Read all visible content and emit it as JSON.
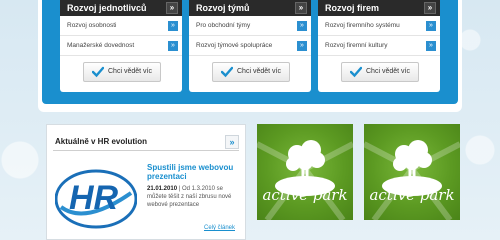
{
  "cards": [
    {
      "title": "Rozvoj jednotlivců",
      "items": [
        "Rozvoj osobnosti",
        "Manažerské dovednost"
      ],
      "button": "Chci vědět víc"
    },
    {
      "title": "Rozvoj týmů",
      "items": [
        "Pro obchodní týmy",
        "Rozvoj týmové spolupráce"
      ],
      "button": "Chci vědět víc"
    },
    {
      "title": "Rozvoj firem",
      "items": [
        "Rozvoj firemního systému",
        "Rozvoj firemní kultury"
      ],
      "button": "Chci vědět víc"
    }
  ],
  "news": {
    "heading": "Aktuálně v HR evolution",
    "article_title": "Spustili jsme webovou prezentaci",
    "date": "21.01.2010",
    "separator": "|",
    "text": "Od 1.3.2010 se můžete těšit z naší zbrusu nové webové prezentace",
    "read_more": "Celý článek",
    "logo_text": "HR"
  },
  "banners": [
    {
      "label": "active park"
    },
    {
      "label": "active park"
    }
  ],
  "colors": {
    "accent": "#1a8fce",
    "card_header": "#2a2a2a",
    "banner_green": "#5c9a22"
  },
  "icons": {
    "chevron": "»",
    "check": "check-icon"
  }
}
